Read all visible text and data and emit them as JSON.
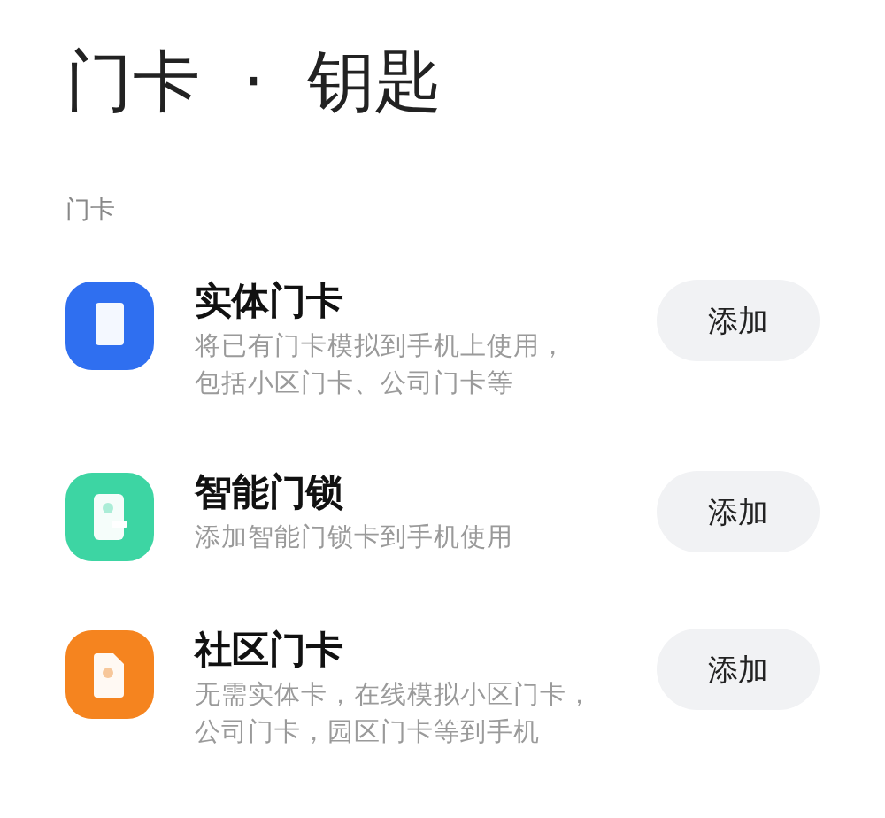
{
  "title": "门卡  ·  钥匙",
  "section": "门卡",
  "items": [
    {
      "kind": "card",
      "color": "#2f6ff0",
      "name": "实体门卡",
      "description": [
        "将已有门卡模拟到手机上使用，",
        "包括小区门卡、公司门卡等"
      ],
      "button": "添加"
    },
    {
      "kind": "lock",
      "color": "#3dd5a3",
      "name": "智能门锁",
      "description": [
        "添加智能门锁卡到手机使用"
      ],
      "button": "添加"
    },
    {
      "kind": "community",
      "color": "#f5841f",
      "name": "社区门卡",
      "description": [
        "无需实体卡，在线模拟小区门卡，",
        "公司门卡，园区门卡等到手机"
      ],
      "button": "添加"
    }
  ]
}
